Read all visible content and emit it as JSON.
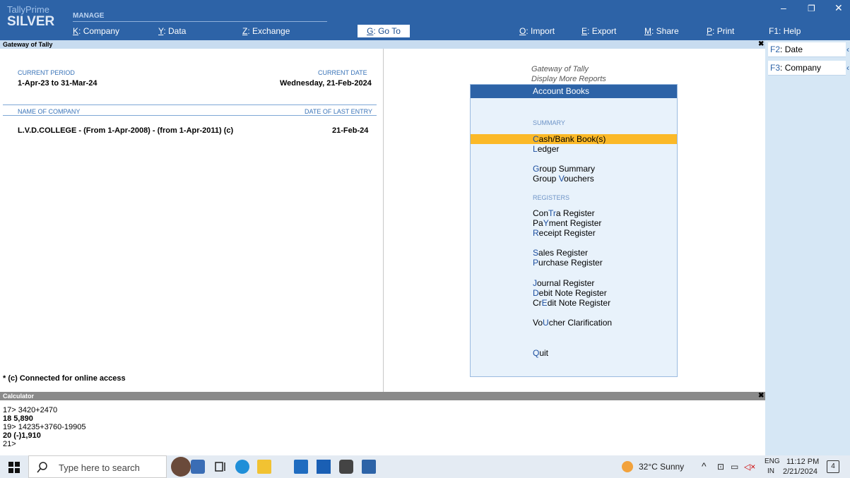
{
  "app": {
    "brand_line1": "TallyPrime",
    "brand_line2": "SILVER",
    "section": "MANAGE",
    "menu": [
      {
        "key": "K",
        "label": "Company"
      },
      {
        "key": "Y",
        "label": "Data"
      },
      {
        "key": "Z",
        "label": "Exchange"
      }
    ],
    "goto": {
      "key": "G",
      "label": "Go To"
    },
    "menu_right": [
      {
        "key": "O",
        "label": "Import"
      },
      {
        "key": "E",
        "label": "Export"
      },
      {
        "key": "M",
        "label": "Share"
      },
      {
        "key": "P",
        "label": "Print"
      },
      {
        "key": "F1",
        "label": "Help"
      }
    ],
    "window_controls": [
      "–",
      "❐",
      "✕"
    ]
  },
  "titlebar": {
    "title": "Gateway of Tally",
    "close": "✖"
  },
  "company_info": {
    "current_period_label": "CURRENT PERIOD",
    "current_period": "1-Apr-23 to 31-Mar-24",
    "current_date_label": "CURRENT DATE",
    "current_date": "Wednesday, 21-Feb-2024",
    "name_label": "NAME OF COMPANY",
    "last_entry_label": "DATE OF LAST ENTRY",
    "company_name": "L.V.D.COLLEGE - (From 1-Apr-2008) - (from 1-Apr-2011) (c)",
    "last_entry_date": "21-Feb-24",
    "footnote": "* (c) Connected for online access"
  },
  "menu_panel": {
    "breadcrumb1": "Gateway of Tally",
    "breadcrumb2": "Display More Reports",
    "title": "Account Books",
    "summary_label": "SUMMARY",
    "registers_label": "REGISTERS",
    "items": [
      {
        "pre": "",
        "key": "C",
        "post": "ash/Bank Book(s)"
      },
      {
        "pre": "",
        "key": "L",
        "post": "edger"
      },
      {
        "pre": "",
        "key": "G",
        "post": "roup Summary"
      },
      {
        "pre": "Group ",
        "key": "V",
        "post": "ouchers"
      },
      {
        "pre": "Con",
        "key": "Tr",
        "post": "a Register"
      },
      {
        "pre": "Pa",
        "key": "Y",
        "post": "ment Register"
      },
      {
        "pre": "",
        "key": "R",
        "post": "eceipt Register"
      },
      {
        "pre": "",
        "key": "S",
        "post": "ales Register"
      },
      {
        "pre": "",
        "key": "P",
        "post": "urchase Register"
      },
      {
        "pre": "",
        "key": "J",
        "post": "ournal Register"
      },
      {
        "pre": "",
        "key": "D",
        "post": "ebit Note Register"
      },
      {
        "pre": "Cr",
        "key": "E",
        "post": "dit Note Register"
      },
      {
        "pre": "Vo",
        "key": "U",
        "post": "cher Clarification"
      },
      {
        "pre": "",
        "key": "Q",
        "post": "uit"
      }
    ]
  },
  "right_panel": [
    {
      "key": "F2",
      "label": "Date"
    },
    {
      "key": "F3",
      "label": "Company"
    }
  ],
  "calculator": {
    "title": "Calculator",
    "lines": [
      "17> 3420+2470",
      "18   5,890",
      "19> 14235+3760-19905",
      "20   (-)1,910",
      "21>"
    ]
  },
  "taskbar": {
    "search_placeholder": "Type here to search",
    "weather": "32°C  Sunny",
    "lang1": "ENG",
    "lang2": "IN",
    "time": "11:12 PM",
    "date": "2/21/2024",
    "notif_count": "4"
  }
}
